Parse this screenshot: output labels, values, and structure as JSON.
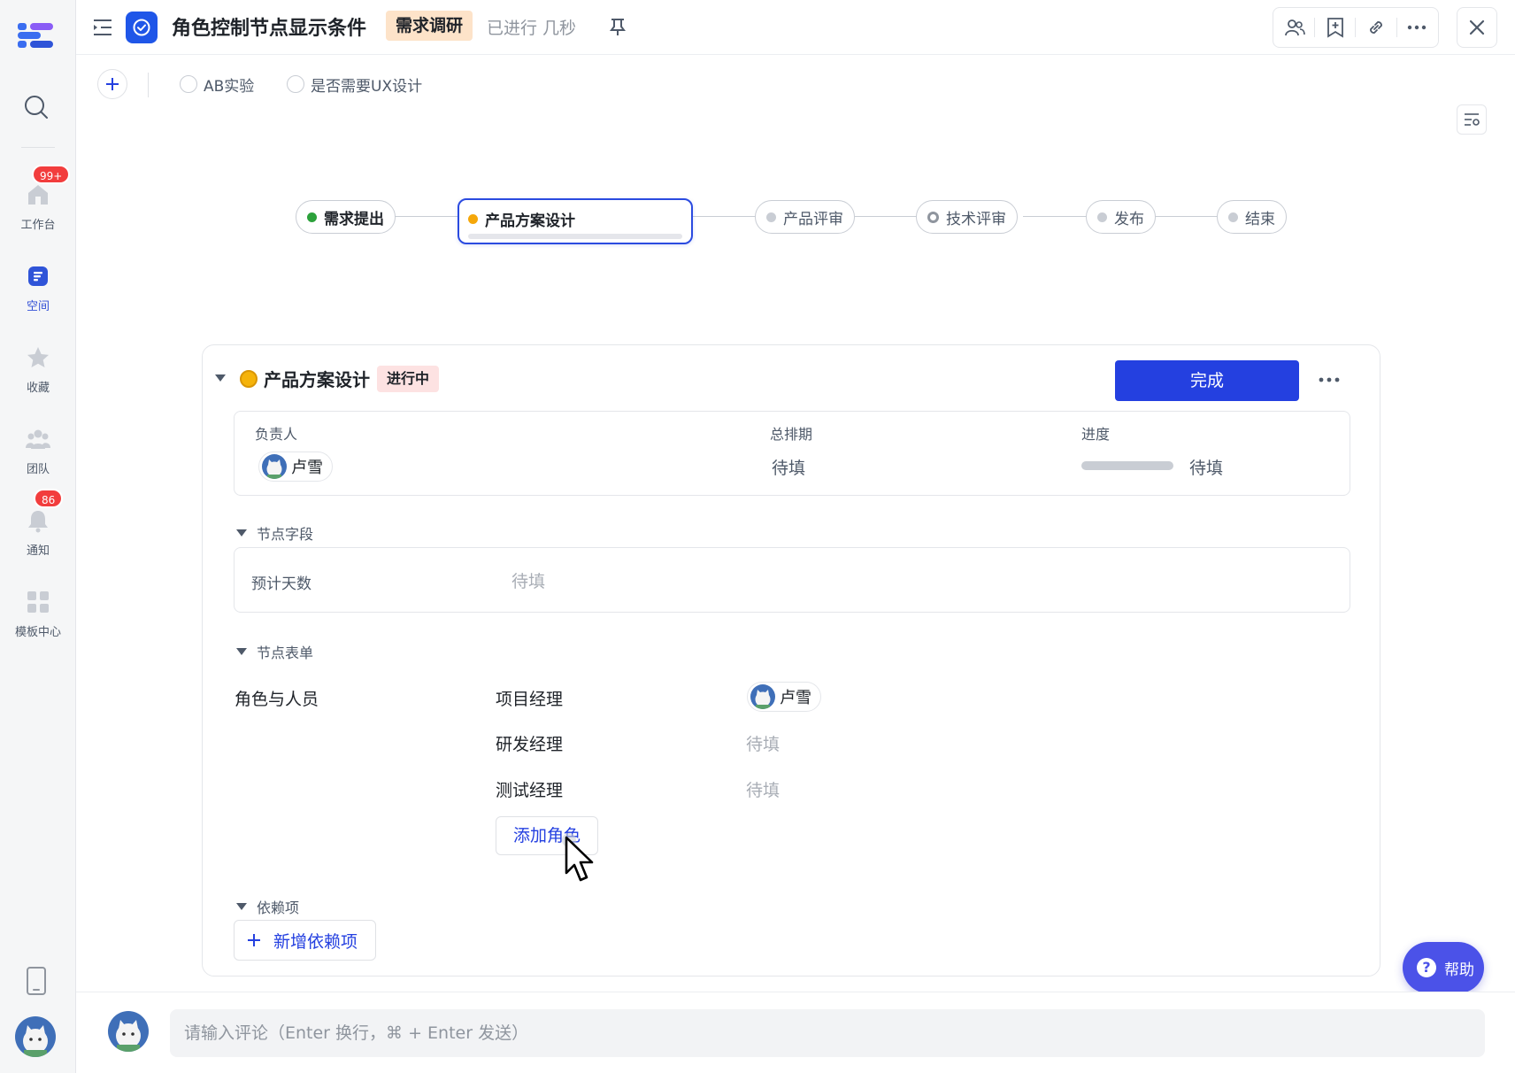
{
  "sidebar": {
    "items": [
      {
        "label": "工作台",
        "icon": "home-icon",
        "badge": "99+"
      },
      {
        "label": "空间",
        "icon": "space-icon",
        "active": true
      },
      {
        "label": "收藏",
        "icon": "star-icon"
      },
      {
        "label": "团队",
        "icon": "team-icon"
      },
      {
        "label": "通知",
        "icon": "bell-icon",
        "badge": "86"
      },
      {
        "label": "模板中心",
        "icon": "template-icon"
      }
    ]
  },
  "header": {
    "title": "角色控制节点显示条件",
    "tag": "需求调研",
    "elapsed": "已进行 几秒"
  },
  "toolbar": {
    "options": [
      "AB实验",
      "是否需要UX设计"
    ]
  },
  "workflow": {
    "nodes": [
      {
        "label": "需求提出",
        "status": "done",
        "color": "#2ca13b"
      },
      {
        "label": "产品方案设计",
        "status": "current",
        "color": "#f5a70a"
      },
      {
        "label": "产品评审",
        "status": "todo",
        "color": "#c9cdd4"
      },
      {
        "label": "技术评审",
        "status": "todo",
        "color": "#8f959e"
      },
      {
        "label": "发布",
        "status": "todo",
        "color": "#c9cdd4"
      },
      {
        "label": "结束",
        "status": "todo",
        "color": "#c9cdd4"
      }
    ]
  },
  "node": {
    "title": "产品方案设计",
    "status": "进行中",
    "complete_label": "完成",
    "owner_label": "负责人",
    "owner_name": "卢雪",
    "schedule_label": "总排期",
    "schedule_value": "待填",
    "progress_label": "进度",
    "progress_value": "待填",
    "progress_fraction": 0
  },
  "fields": {
    "title": "节点字段",
    "items": [
      {
        "label": "预计天数",
        "value": "待填"
      }
    ]
  },
  "form": {
    "title": "节点表单",
    "group_label": "角色与人员",
    "roles": [
      {
        "name": "项目经理",
        "assignee": "卢雪"
      },
      {
        "name": "研发经理",
        "assignee": "待填"
      },
      {
        "name": "测试经理",
        "assignee": "待填"
      }
    ],
    "add_role_label": "添加角色"
  },
  "dependencies": {
    "title": "依赖项",
    "add_label": "新增依赖项"
  },
  "help": {
    "label": "帮助"
  },
  "comment": {
    "placeholder": "请输入评论（Enter 换行，⌘ + Enter 发送）"
  }
}
